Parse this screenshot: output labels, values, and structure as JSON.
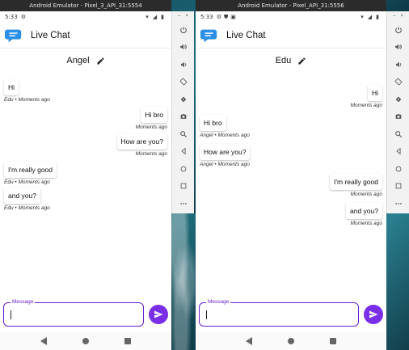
{
  "left_emulator": {
    "window_title": "Android Emulator - Pixel_3_API_31:5554",
    "status_time": "5:33",
    "app_title": "Live Chat",
    "peer_name": "Angel",
    "messages": [
      {
        "side": "left",
        "text": "Hi",
        "meta": "Edu • Moments ago"
      },
      {
        "side": "right",
        "text": "Hi bro",
        "meta": "Moments ago"
      },
      {
        "side": "right",
        "text": "How are you?",
        "meta": "Moments ago"
      },
      {
        "side": "left",
        "text": "I'm really good",
        "meta": "Edu • Moments ago"
      },
      {
        "side": "left",
        "text": "and you?",
        "meta": "Edu • Moments ago"
      }
    ],
    "input_label": "Message"
  },
  "right_emulator": {
    "window_title": "Android Emulator - Pixel_API_31:5556",
    "status_time": "5:33",
    "app_title": "Live Chat",
    "peer_name": "Edu",
    "messages": [
      {
        "side": "right",
        "text": "Hi",
        "meta": "Moments ago"
      },
      {
        "side": "left",
        "text": "Hi bro",
        "meta": "Angel • Moments ago"
      },
      {
        "side": "left",
        "text": "How are you?",
        "meta": "Angel • Moments ago"
      },
      {
        "side": "right",
        "text": "I'm really good",
        "meta": "Moments ago"
      },
      {
        "side": "right",
        "text": "and you?",
        "meta": "Moments ago"
      }
    ],
    "input_label": "Message"
  },
  "toolbar": {
    "items": [
      "power-icon",
      "volume-up-icon",
      "volume-down-icon",
      "rotate-left-icon",
      "rotate-right-icon",
      "camera-icon",
      "zoom-icon",
      "back-icon",
      "home-icon",
      "overview-icon",
      "more-icon"
    ]
  },
  "colors": {
    "accent": "#7b2ee8",
    "input_border": "#6a1fd6",
    "logo": "#2a8fe6"
  }
}
